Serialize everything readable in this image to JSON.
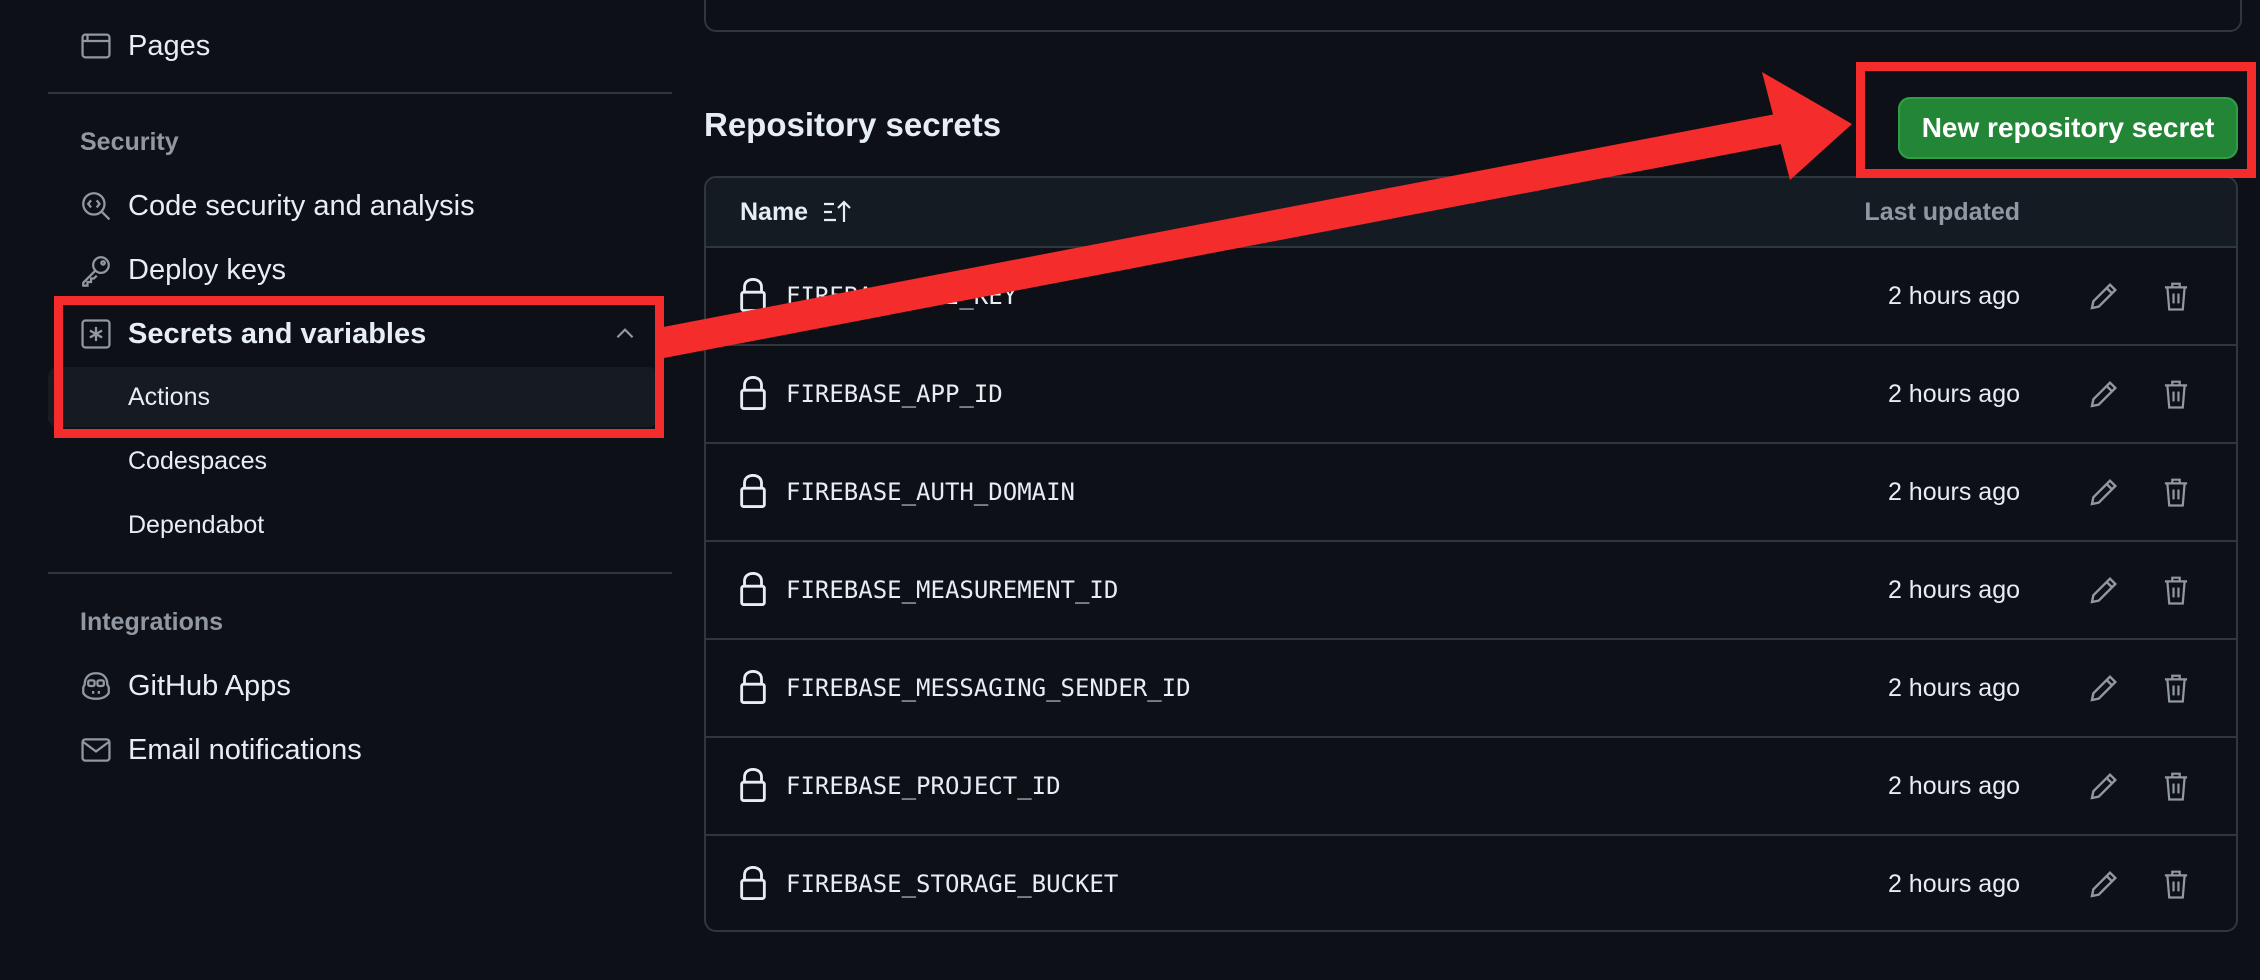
{
  "sidebar": {
    "pages_label": "Pages",
    "security_heading": "Security",
    "code_security_label": "Code security and analysis",
    "deploy_keys_label": "Deploy keys",
    "secrets_label": "Secrets and variables",
    "sub_actions": "Actions",
    "sub_codespaces": "Codespaces",
    "sub_dependabot": "Dependabot",
    "integrations_heading": "Integrations",
    "github_apps_label": "GitHub Apps",
    "email_notifications_label": "Email notifications"
  },
  "main": {
    "title": "Repository secrets",
    "new_button_label": "New repository secret",
    "table": {
      "col_name": "Name",
      "col_updated": "Last updated",
      "rows": [
        {
          "name": "FIREBASE_API_KEY",
          "updated": "2 hours ago"
        },
        {
          "name": "FIREBASE_APP_ID",
          "updated": "2 hours ago"
        },
        {
          "name": "FIREBASE_AUTH_DOMAIN",
          "updated": "2 hours ago"
        },
        {
          "name": "FIREBASE_MEASUREMENT_ID",
          "updated": "2 hours ago"
        },
        {
          "name": "FIREBASE_MESSAGING_SENDER_ID",
          "updated": "2 hours ago"
        },
        {
          "name": "FIREBASE_PROJECT_ID",
          "updated": "2 hours ago"
        },
        {
          "name": "FIREBASE_STORAGE_BUCKET",
          "updated": "2 hours ago"
        }
      ]
    }
  },
  "colors": {
    "background": "#0d1117",
    "accent_green": "#238636",
    "annotation_red": "#f52c2c",
    "selection_blue": "#4493f8"
  },
  "icons": {
    "pages": "browser-icon",
    "code_security": "codescan-icon",
    "deploy_keys": "key-icon",
    "secrets": "asterisk-icon",
    "github_apps": "copilot-icon",
    "email": "mail-icon",
    "sort": "sort-asc-icon",
    "lock": "lock-icon",
    "edit": "pencil-icon",
    "delete": "trash-icon"
  }
}
